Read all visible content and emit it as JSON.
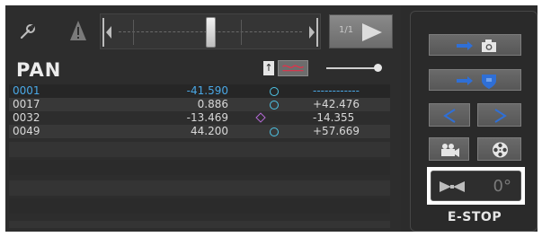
{
  "toolbar": {
    "page_count": "1/1"
  },
  "axis": {
    "title": "PAN",
    "up_label": "↑"
  },
  "rows": [
    {
      "id": "0001",
      "value": "-41.590",
      "ref": "------------",
      "marker": "circle"
    },
    {
      "id": "0017",
      "value": "0.886",
      "ref": "+42.476",
      "marker": "circle"
    },
    {
      "id": "0032",
      "value": "-13.469",
      "ref": "-14.355",
      "marker": "diamond"
    },
    {
      "id": "0049",
      "value": "44.200",
      "ref": "+57.669",
      "marker": "circle"
    }
  ],
  "right": {
    "dial_value": "0°",
    "estop_label": "E-STOP",
    "prev_label": "<",
    "next_label": ">"
  },
  "icons": {
    "toolbar": [
      "wrench-icon",
      "warning-icon",
      "skip-start-icon",
      "skip-end-icon",
      "play-icon"
    ],
    "right": [
      "camera-icon",
      "shield-icon",
      "video-camera-icon",
      "film-reel-icon",
      "bowtie-icon"
    ]
  },
  "colors": {
    "accent_blue": "#2f6fd6",
    "selected_text": "#4aa8e6",
    "marker_circle": "#4fc6e8",
    "marker_diamond": "#b66ad8",
    "wave": "#e0324a"
  }
}
